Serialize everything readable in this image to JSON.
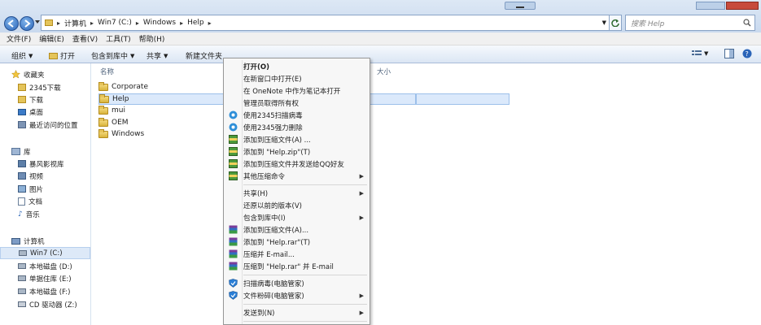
{
  "address": {
    "crumbs": [
      "计算机",
      "Win7 (C:)",
      "Windows",
      "Help"
    ],
    "search_placeholder": "搜索 Help"
  },
  "menubar": [
    "文件(F)",
    "编辑(E)",
    "查看(V)",
    "工具(T)",
    "帮助(H)"
  ],
  "toolbar": {
    "organize": "组织",
    "open": "打开",
    "include": "包含到库中",
    "share": "共享",
    "newfolder": "新建文件夹"
  },
  "navpane": {
    "favorites": "收藏夹",
    "fav_items": [
      "2345下载",
      "下载",
      "桌面",
      "最近访问的位置"
    ],
    "libraries": "库",
    "lib_items": [
      "暴风影视库",
      "视频",
      "图片",
      "文档",
      "音乐"
    ],
    "computer": "计算机",
    "drives": [
      "Win7 (C:)",
      "本地磁盘 (D:)",
      "单据住库 (E:)",
      "本地磁盘 (F:)",
      "CD 驱动器 (Z:)"
    ]
  },
  "content": {
    "col_name": "名称",
    "col_size": "大小",
    "files": [
      "Corporate",
      "Help",
      "mui",
      "OEM",
      "Windows"
    ]
  },
  "context_menu": {
    "items": [
      {
        "label": "打开(O)",
        "bold": true,
        "icon": "",
        "sub": false
      },
      {
        "label": "在新窗口中打开(E)",
        "icon": "",
        "sub": false
      },
      {
        "label": "在 OneNote 中作为笔记本打开",
        "icon": "",
        "sub": false
      },
      {
        "label": "管理员取得所有权",
        "icon": "",
        "sub": false
      },
      {
        "label": "使用2345扫描病毒",
        "icon": "shield-2345-icon",
        "sub": false
      },
      {
        "label": "使用2345强力删除",
        "icon": "shield-2345-icon",
        "sub": false
      },
      {
        "label": "添加到压缩文件(A) ...",
        "icon": "archive-icon",
        "sub": false
      },
      {
        "label": "添加到 \"Help.zip\"(T)",
        "icon": "archive-icon",
        "sub": false
      },
      {
        "label": "添加到压缩文件并发送给QQ好友",
        "icon": "archive-icon",
        "sub": false
      },
      {
        "label": "其他压缩命令",
        "icon": "archive-icon",
        "sub": true
      },
      {
        "label": "共享(H)",
        "icon": "",
        "sub": true
      },
      {
        "label": "还原以前的版本(V)",
        "icon": "",
        "sub": false
      },
      {
        "label": "包含到库中(I)",
        "icon": "",
        "sub": true
      },
      {
        "label": "添加到压缩文件(A)...",
        "icon": "winrar-icon",
        "sub": false
      },
      {
        "label": "添加到 \"Help.rar\"(T)",
        "icon": "winrar-icon",
        "sub": false
      },
      {
        "label": "压缩并 E-mail...",
        "icon": "winrar-icon",
        "sub": false
      },
      {
        "label": "压缩到 \"Help.rar\" 并 E-mail",
        "icon": "winrar-icon",
        "sub": false
      },
      {
        "label": "扫描病毒(电脑管家)",
        "icon": "guard-icon",
        "sub": false
      },
      {
        "label": "文件粉碎(电脑管家)",
        "icon": "guard-icon",
        "sub": true
      },
      {
        "label": "发送到(N)",
        "icon": "",
        "sub": true
      }
    ]
  }
}
